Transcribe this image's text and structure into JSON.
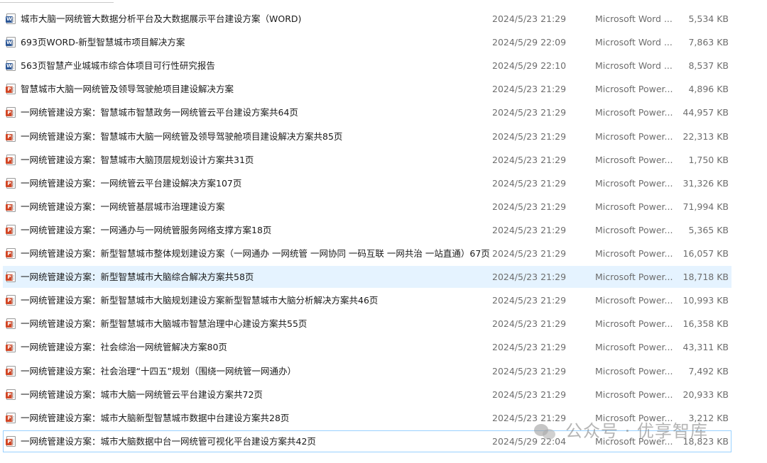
{
  "colors": {
    "word_icon": "#2b5797",
    "ppt_icon": "#d24726",
    "hover_background": "#e5f3ff",
    "focus_border": "#99d1ff",
    "meta_text": "#6d6d6d"
  },
  "files": [
    {
      "name": "城市大脑一网统管大数据分析平台及大数据展示平台建设方案（WORD)",
      "modified": "2024/5/23 21:29",
      "type": "Microsoft Word ...",
      "size": "5,534 KB",
      "icon": "word-doc-icon",
      "icon_badge": "W"
    },
    {
      "name": "693页WORD-新型智慧城市项目解决方案",
      "modified": "2024/5/29 22:09",
      "type": "Microsoft Word ...",
      "size": "7,863 KB",
      "icon": "word-doc-icon",
      "icon_badge": "W"
    },
    {
      "name": "563页智慧产业城城市综合体项目可行性研究报告",
      "modified": "2024/5/29 22:10",
      "type": "Microsoft Word ...",
      "size": "8,537 KB",
      "icon": "word-doc-icon",
      "icon_badge": "W"
    },
    {
      "name": "智慧城市大脑一网统管及领导驾驶舱项目建设解决方案",
      "modified": "2024/5/23 21:29",
      "type": "Microsoft Power...",
      "size": "4,896 KB",
      "icon": "powerpoint-icon",
      "icon_badge": "P"
    },
    {
      "name": "一网统管建设方案：智慧城市智慧政务一网统管云平台建设方案共64页",
      "modified": "2024/5/23 21:29",
      "type": "Microsoft Power...",
      "size": "44,957 KB",
      "icon": "powerpoint-icon",
      "icon_badge": "P"
    },
    {
      "name": "一网统管建设方案：智慧城市大脑一网统管及领导驾驶舱项目建设解决方案共85页",
      "modified": "2024/5/23 21:29",
      "type": "Microsoft Power...",
      "size": "22,313 KB",
      "icon": "powerpoint-icon",
      "icon_badge": "P"
    },
    {
      "name": "一网统管建设方案：智慧城市大脑顶层规划设计方案共31页",
      "modified": "2024/5/23 21:29",
      "type": "Microsoft Power...",
      "size": "1,750 KB",
      "icon": "powerpoint-icon",
      "icon_badge": "P"
    },
    {
      "name": "一网统管建设方案：一网统管云平台建设解决方案107页",
      "modified": "2024/5/23 21:29",
      "type": "Microsoft Power...",
      "size": "31,326 KB",
      "icon": "powerpoint-icon",
      "icon_badge": "P"
    },
    {
      "name": "一网统管建设方案：一网统管基层城市治理建设方案",
      "modified": "2024/5/23 21:29",
      "type": "Microsoft Power...",
      "size": "71,994 KB",
      "icon": "powerpoint-icon",
      "icon_badge": "P"
    },
    {
      "name": "一网统管建设方案：一网通办与一网统管服务网络支撑方案18页",
      "modified": "2024/5/23 21:29",
      "type": "Microsoft Power...",
      "size": "5,365 KB",
      "icon": "powerpoint-icon",
      "icon_badge": "P"
    },
    {
      "name": "一网统管建设方案：新型智慧城市整体规划建设方案（一网通办 一网统管 一网协同 一码互联 一网共治 一站直通）67页",
      "modified": "2024/5/23 21:29",
      "type": "Microsoft Power...",
      "size": "16,057 KB",
      "icon": "powerpoint-icon",
      "icon_badge": "P"
    },
    {
      "name": "一网统管建设方案：新型智慧城市大脑综合解决方案共58页",
      "modified": "2024/5/23 21:29",
      "type": "Microsoft Power...",
      "size": "18,718 KB",
      "icon": "powerpoint-icon",
      "icon_badge": "P",
      "state": "hover"
    },
    {
      "name": "一网统管建设方案：新型智慧城市大脑规划建设方案新型智慧城市大脑分析解决方案共46页",
      "modified": "2024/5/23 21:29",
      "type": "Microsoft Power...",
      "size": "10,993 KB",
      "icon": "powerpoint-icon",
      "icon_badge": "P"
    },
    {
      "name": "一网统管建设方案：新型智慧城市大脑城市智慧治理中心建设方案共55页",
      "modified": "2024/5/23 21:29",
      "type": "Microsoft Power...",
      "size": "16,358 KB",
      "icon": "powerpoint-icon",
      "icon_badge": "P"
    },
    {
      "name": "一网统管建设方案：社会综治一网统管解决方案80页",
      "modified": "2024/5/23 21:29",
      "type": "Microsoft Power...",
      "size": "43,311 KB",
      "icon": "powerpoint-icon",
      "icon_badge": "P"
    },
    {
      "name": "一网统管建设方案：社会治理“十四五”规划（围绕一网统管一网通办）",
      "modified": "2024/5/23 21:29",
      "type": "Microsoft Power...",
      "size": "7,492 KB",
      "icon": "powerpoint-icon",
      "icon_badge": "P"
    },
    {
      "name": "一网统管建设方案：城市大脑一网统管云平台建设方案共72页",
      "modified": "2024/5/23 21:29",
      "type": "Microsoft Power...",
      "size": "20,933 KB",
      "icon": "powerpoint-icon",
      "icon_badge": "P"
    },
    {
      "name": "一网统管建设方案：城市大脑新型智慧城市数据中台建设方案共28页",
      "modified": "2024/5/23 21:29",
      "type": "Microsoft Power...",
      "size": "3,212 KB",
      "icon": "powerpoint-icon",
      "icon_badge": "P"
    },
    {
      "name": "一网统管建设方案：城市大脑数据中台一网统管可视化平台建设方案共42页",
      "modified": "2024/5/29 22:04",
      "type": "Microsoft Power...",
      "size": "18,823 KB",
      "icon": "powerpoint-icon",
      "icon_badge": "P",
      "state": "focus"
    }
  ],
  "watermark": {
    "text": "公众号 · 优享智库",
    "icon": "wechat-logo-icon"
  }
}
